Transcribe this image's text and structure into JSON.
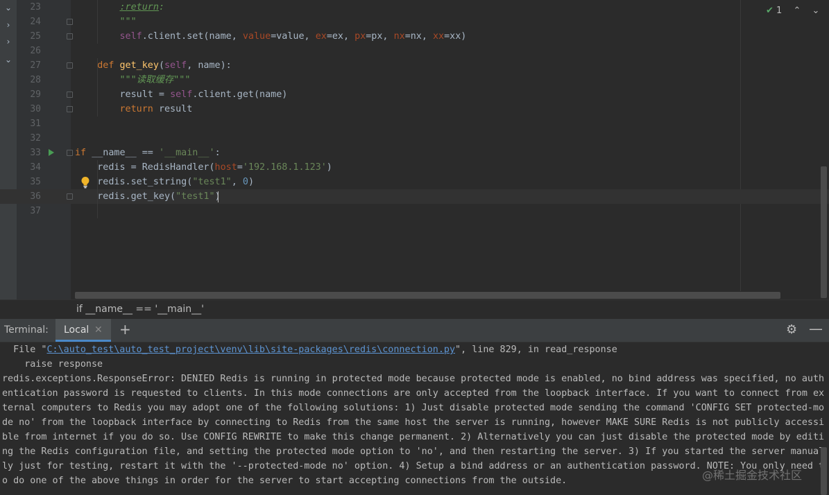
{
  "editor": {
    "inspection_count": "1",
    "lines": [
      {
        "num": "23",
        "code": [
          {
            "t": "        ",
            "c": ""
          },
          {
            "t": ":return",
            "c": "doctag"
          },
          {
            "t": ":",
            "c": "doc"
          }
        ]
      },
      {
        "num": "24",
        "code": [
          {
            "t": "        ",
            "c": ""
          },
          {
            "t": "\"\"\"",
            "c": "doc"
          }
        ]
      },
      {
        "num": "25",
        "code": [
          {
            "t": "        ",
            "c": ""
          },
          {
            "t": "self",
            "c": "self"
          },
          {
            "t": ".client.set(name, ",
            "c": ""
          },
          {
            "t": "value",
            "c": "param"
          },
          {
            "t": "=value, ",
            "c": ""
          },
          {
            "t": "ex",
            "c": "param"
          },
          {
            "t": "=ex, ",
            "c": ""
          },
          {
            "t": "px",
            "c": "param"
          },
          {
            "t": "=px, ",
            "c": ""
          },
          {
            "t": "nx",
            "c": "param"
          },
          {
            "t": "=nx, ",
            "c": ""
          },
          {
            "t": "xx",
            "c": "param"
          },
          {
            "t": "=xx)",
            "c": ""
          }
        ]
      },
      {
        "num": "26",
        "code": []
      },
      {
        "num": "27",
        "code": [
          {
            "t": "    ",
            "c": ""
          },
          {
            "t": "def ",
            "c": "kw"
          },
          {
            "t": "get_key",
            "c": "fn"
          },
          {
            "t": "(",
            "c": ""
          },
          {
            "t": "self",
            "c": "self"
          },
          {
            "t": ", name):",
            "c": ""
          }
        ]
      },
      {
        "num": "28",
        "code": [
          {
            "t": "        ",
            "c": ""
          },
          {
            "t": "\"\"\"读取缓存\"\"\"",
            "c": "doc"
          }
        ]
      },
      {
        "num": "29",
        "code": [
          {
            "t": "        result = ",
            "c": ""
          },
          {
            "t": "self",
            "c": "self"
          },
          {
            "t": ".client.get(name)",
            "c": ""
          }
        ]
      },
      {
        "num": "30",
        "code": [
          {
            "t": "        ",
            "c": ""
          },
          {
            "t": "return ",
            "c": "kw"
          },
          {
            "t": "result",
            "c": ""
          }
        ]
      },
      {
        "num": "31",
        "code": []
      },
      {
        "num": "32",
        "code": []
      },
      {
        "num": "33",
        "code": [
          {
            "t": "if ",
            "c": "kw"
          },
          {
            "t": "__name__ == ",
            "c": ""
          },
          {
            "t": "'__main__'",
            "c": "str"
          },
          {
            "t": ":",
            "c": ""
          }
        ]
      },
      {
        "num": "34",
        "code": [
          {
            "t": "    redis = RedisHandler(",
            "c": ""
          },
          {
            "t": "host",
            "c": "param"
          },
          {
            "t": "=",
            "c": ""
          },
          {
            "t": "'192.168.1.123'",
            "c": "str"
          },
          {
            "t": ")",
            "c": ""
          }
        ]
      },
      {
        "num": "35",
        "code": [
          {
            "t": "    redis.set_string(",
            "c": ""
          },
          {
            "t": "\"test1\"",
            "c": "str"
          },
          {
            "t": ", ",
            "c": ""
          },
          {
            "t": "0",
            "c": "num"
          },
          {
            "t": ")",
            "c": ""
          }
        ]
      },
      {
        "num": "36",
        "code": [
          {
            "t": "    redis.get_key(",
            "c": ""
          },
          {
            "t": "\"test1\"",
            "c": "str"
          },
          {
            "t": ")",
            "c": ""
          }
        ]
      },
      {
        "num": "37",
        "code": []
      }
    ]
  },
  "breadcrumb": "if __name__ == '__main__'",
  "terminal": {
    "title": "Terminal:",
    "tab_label": "Local",
    "traceback_prefix": "  File \"",
    "traceback_path": "C:\\auto_test\\auto_test_project\\venv\\lib\\site-packages\\redis\\connection.py",
    "traceback_suffix": "\", line 829, in read_response",
    "raise_line": "    raise response",
    "error_lines": [
      "redis.exceptions.ResponseError: DENIED Redis is running in protected mode because protected mode is enabled, no bind address was specified, no auth",
      "entication password is requested to clients. In this mode connections are only accepted from the loopback interface. If you want to connect from ex",
      "ternal computers to Redis you may adopt one of the following solutions: 1) Just disable protected mode sending the command 'CONFIG SET protected-mo",
      "de no' from the loopback interface by connecting to Redis from the same host the server is running, however MAKE SURE Redis is not publicly accessi",
      "ble from internet if you do so. Use CONFIG REWRITE to make this change permanent. 2) Alternatively you can just disable the protected mode by editi",
      "ng the Redis configuration file, and setting the protected mode option to 'no', and then restarting the server. 3) If you started the server manual",
      "ly just for testing, restart it with the '--protected-mode no' option. 4) Setup a bind address or an authentication password. NOTE: You only need t",
      "o do one of the above things in order for the server to start accepting connections from the outside."
    ]
  },
  "watermark": "@稀土掘金技术社区",
  "colors": {
    "editor_bg": "#2b2b2b",
    "keyword": "#cc7832",
    "string": "#6a8759",
    "docstring": "#629755",
    "function": "#ffc66d",
    "self": "#94558d",
    "param": "#aa4926",
    "number": "#6897bb",
    "link": "#5d94d2",
    "tab_accent": "#4a88c7"
  },
  "icons": [
    "chevron-down-icon",
    "chevron-right-icon",
    "fold-icon",
    "run-arrow-icon",
    "lightbulb-icon",
    "check-icon",
    "chevron-up-icon",
    "close-icon",
    "plus-icon",
    "gear-icon",
    "minimize-icon"
  ]
}
